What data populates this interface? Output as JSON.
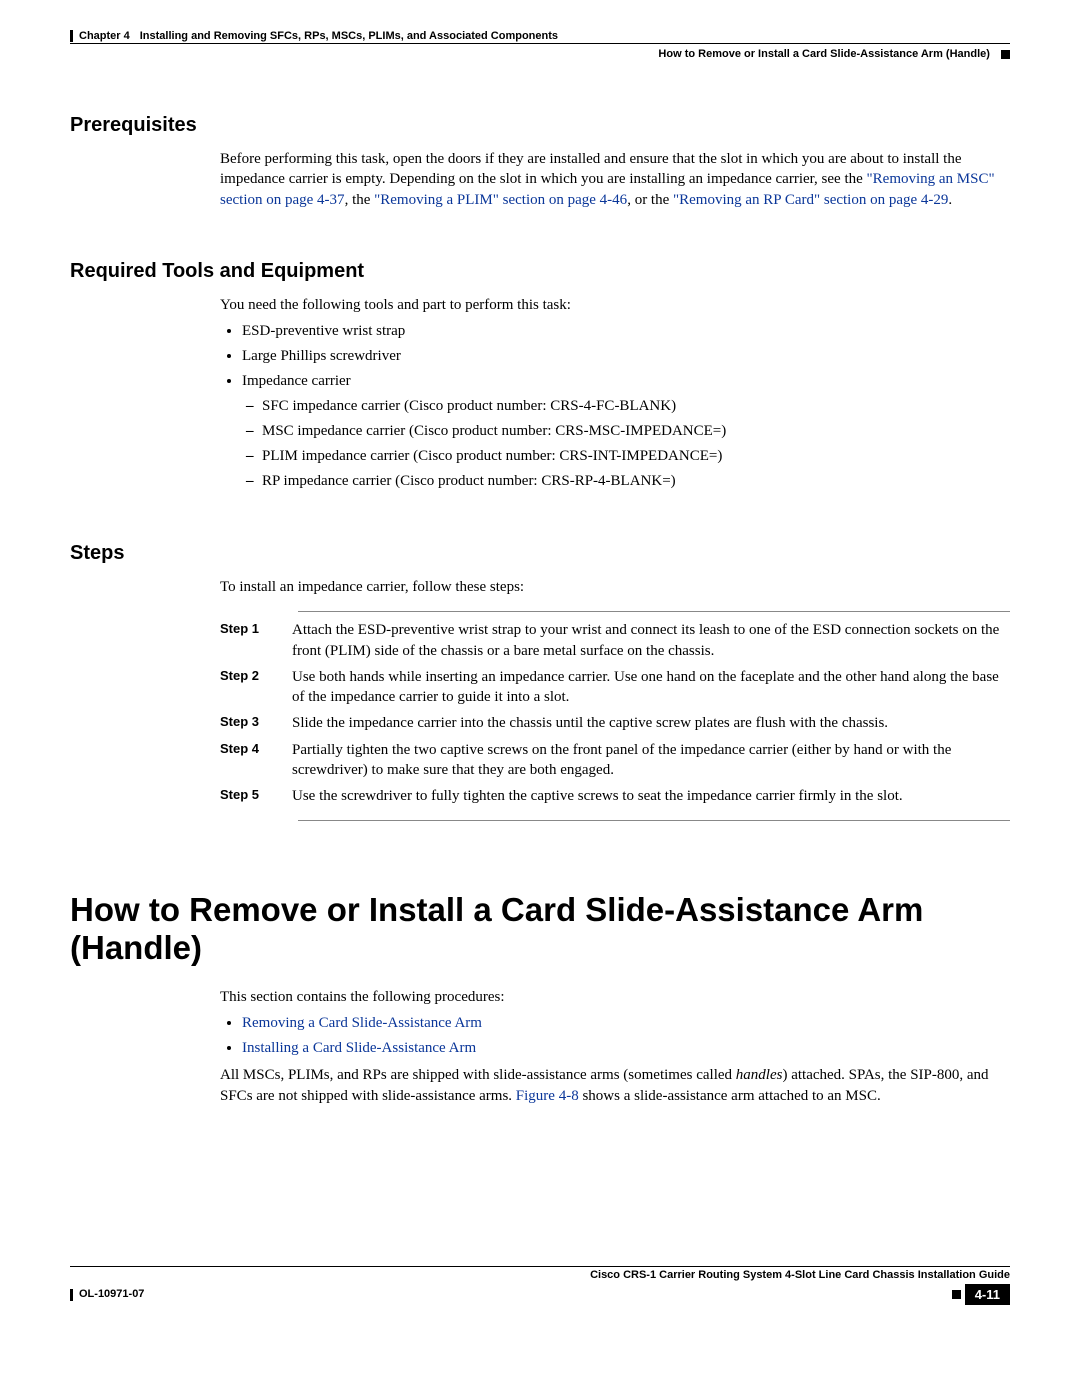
{
  "runningHeader": {
    "chapterLabel": "Chapter 4",
    "chapterTitle": "Installing and Removing SFCs, RPs, MSCs, PLIMs, and Associated Components",
    "sectionTitle": "How to Remove or Install a Card Slide-Assistance Arm (Handle)"
  },
  "sections": {
    "prereq": {
      "heading": "Prerequisites",
      "para_a": "Before performing this task, open the doors if they are installed and ensure that the slot in which you are about to install the impedance carrier is empty. Depending on the slot in which you are installing an impedance carrier, see the ",
      "link1": "\"Removing an MSC\" section on page 4-37",
      "mid1": ", the ",
      "link2": "\"Removing a PLIM\" section on page 4-46",
      "mid2": ", or the ",
      "link3": "\"Removing an RP Card\" section on page 4-29",
      "end": "."
    },
    "tools": {
      "heading": "Required Tools and Equipment",
      "intro": "You need the following tools and part to perform this task:",
      "items": [
        "ESD-preventive wrist strap",
        "Large Phillips screwdriver",
        "Impedance carrier"
      ],
      "subitems": [
        "SFC impedance carrier (Cisco product number: CRS-4-FC-BLANK)",
        "MSC impedance carrier (Cisco product number: CRS-MSC-IMPEDANCE=)",
        "PLIM impedance carrier (Cisco product number: CRS-INT-IMPEDANCE=)",
        "RP impedance carrier (Cisco product number: CRS-RP-4-BLANK=)"
      ]
    },
    "steps": {
      "heading": "Steps",
      "intro": "To install an impedance carrier, follow these steps:",
      "rows": [
        {
          "label": "Step 1",
          "text": "Attach the ESD-preventive wrist strap to your wrist and connect its leash to one of the ESD connection sockets on the front (PLIM) side of the chassis or a bare metal surface on the chassis."
        },
        {
          "label": "Step 2",
          "text": "Use both hands while inserting an impedance carrier. Use one hand on the faceplate and the other hand along the base of the impedance carrier to guide it into a slot."
        },
        {
          "label": "Step 3",
          "text": "Slide the impedance carrier into the chassis until the captive screw plates are flush with the chassis."
        },
        {
          "label": "Step 4",
          "text": "Partially tighten the two captive screws on the front panel of the impedance carrier (either by hand or with the screwdriver) to make sure that they are both engaged."
        },
        {
          "label": "Step 5",
          "text": "Use the screwdriver to fully tighten the captive screws to seat the impedance carrier firmly in the slot."
        }
      ]
    },
    "main": {
      "heading": "How to Remove or Install a Card Slide-Assistance Arm (Handle)",
      "intro": "This section contains the following procedures:",
      "links": [
        "Removing a Card Slide-Assistance Arm",
        "Installing a Card Slide-Assistance Arm"
      ],
      "para_a": "All MSCs, PLIMs, and RPs are shipped with slide-assistance arms (sometimes called ",
      "italic": "handles",
      "para_b": ") attached. SPAs, the SIP-800, and SFCs are not shipped with slide-assistance arms. ",
      "figlink": "Figure 4-8",
      "para_c": " shows a slide-assistance arm attached to an MSC."
    }
  },
  "footer": {
    "guide": "Cisco CRS-1 Carrier Routing System 4-Slot Line Card Chassis Installation Guide",
    "docnum": "OL-10971-07",
    "pagenum": "4-11"
  }
}
